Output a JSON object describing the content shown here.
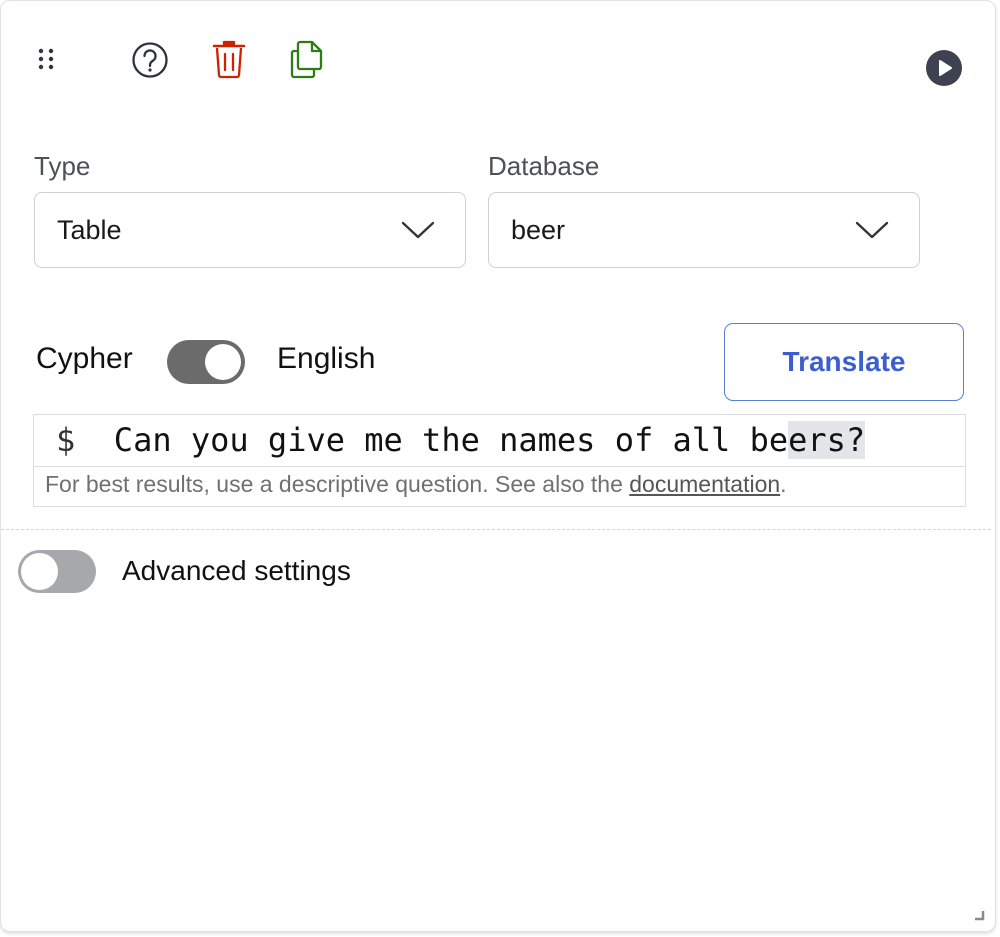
{
  "toolbar": {
    "icons": {
      "drag": "drag-handle-icon",
      "help": "help-circle-icon",
      "delete": "trash-icon",
      "duplicate": "copy-icon",
      "run": "play-circle-icon"
    },
    "colors": {
      "delete": "#cc2200",
      "duplicate": "#2e7d12",
      "run": "#3d4150",
      "help": "#2d3340"
    }
  },
  "form": {
    "type_label": "Type",
    "type_value": "Table",
    "database_label": "Database",
    "database_value": "beer"
  },
  "mode_toggle": {
    "left_label": "Cypher",
    "right_label": "English",
    "selected": "English",
    "translate_label": "Translate"
  },
  "editor": {
    "prompt": "$",
    "text_before_selection": "Can you give me the names of all be",
    "selected_text": "ers?",
    "hint_text": "For best results, use a descriptive question. See also the ",
    "hint_link": "documentation",
    "hint_suffix": "."
  },
  "advanced": {
    "label": "Advanced settings",
    "enabled": false
  },
  "colors": {
    "accent": "#3b5fcd",
    "toggle_on": "#6b6b6b",
    "toggle_off": "#a6a8ab"
  }
}
